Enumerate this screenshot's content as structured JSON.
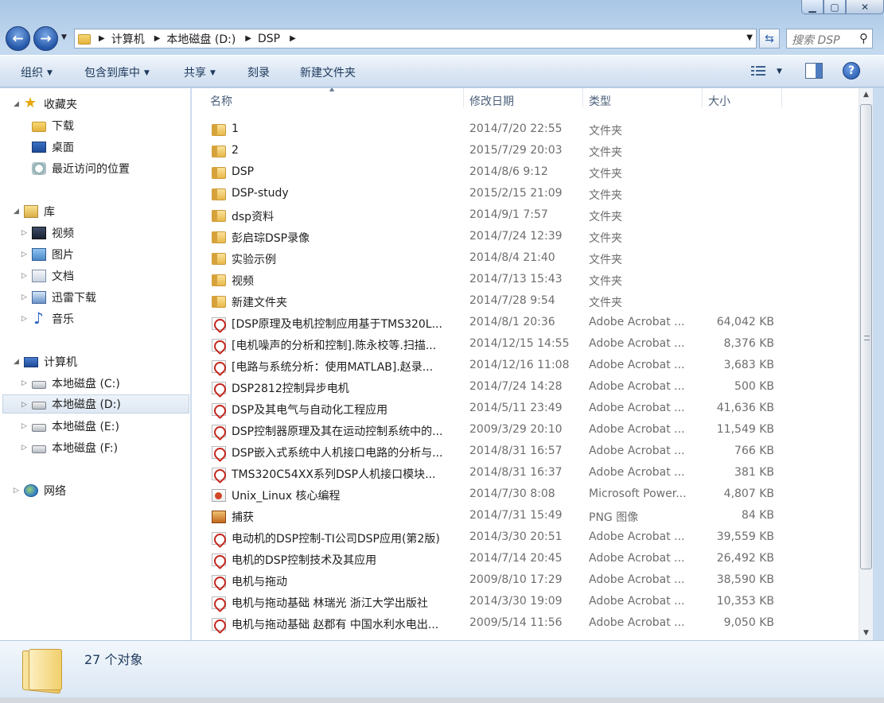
{
  "address": {
    "segments": [
      "计算机",
      "本地磁盘 (D:)",
      "DSP"
    ]
  },
  "search": {
    "placeholder": "搜索 DSP"
  },
  "toolbar": {
    "organize": "组织",
    "include_library": "包含到库中",
    "share": "共享",
    "burn": "刻录",
    "new_folder": "新建文件夹"
  },
  "nav": {
    "favorites": "收藏夹",
    "downloads": "下载",
    "desktop": "桌面",
    "recent": "最近访问的位置",
    "libraries": "库",
    "videos": "视频",
    "pictures": "图片",
    "documents": "文档",
    "xunlei": "迅雷下载",
    "music": "音乐",
    "computer": "计算机",
    "drive_c": "本地磁盘 (C:)",
    "drive_d": "本地磁盘 (D:)",
    "drive_e": "本地磁盘 (E:)",
    "drive_f": "本地磁盘 (F:)",
    "network": "网络"
  },
  "columns": {
    "name": "名称",
    "date": "修改日期",
    "type": "类型",
    "size": "大小"
  },
  "files": [
    {
      "icon": "folder",
      "name": "1",
      "date": "2014/7/20 22:55",
      "type": "文件夹",
      "size": ""
    },
    {
      "icon": "folder",
      "name": "2",
      "date": "2015/7/29 20:03",
      "type": "文件夹",
      "size": ""
    },
    {
      "icon": "folder",
      "name": "DSP",
      "date": "2014/8/6 9:12",
      "type": "文件夹",
      "size": ""
    },
    {
      "icon": "folder",
      "name": "DSP-study",
      "date": "2015/2/15 21:09",
      "type": "文件夹",
      "size": ""
    },
    {
      "icon": "folder",
      "name": "dsp资料",
      "date": "2014/9/1 7:57",
      "type": "文件夹",
      "size": ""
    },
    {
      "icon": "folder",
      "name": "彭启琮DSP录像",
      "date": "2014/7/24 12:39",
      "type": "文件夹",
      "size": ""
    },
    {
      "icon": "folder",
      "name": "实验示例",
      "date": "2014/8/4 21:40",
      "type": "文件夹",
      "size": ""
    },
    {
      "icon": "folder",
      "name": "视频",
      "date": "2014/7/13 15:43",
      "type": "文件夹",
      "size": ""
    },
    {
      "icon": "folder",
      "name": "新建文件夹",
      "date": "2014/7/28 9:54",
      "type": "文件夹",
      "size": ""
    },
    {
      "icon": "pdf",
      "name": "[DSP原理及电机控制应用基于TMS320L...",
      "date": "2014/8/1 20:36",
      "type": "Adobe Acrobat ...",
      "size": "64,042 KB"
    },
    {
      "icon": "pdf",
      "name": "[电机噪声的分析和控制].陈永校等.扫描...",
      "date": "2014/12/15 14:55",
      "type": "Adobe Acrobat ...",
      "size": "8,376 KB"
    },
    {
      "icon": "pdf",
      "name": "[电路与系统分析：使用MATLAB].赵录...",
      "date": "2014/12/16 11:08",
      "type": "Adobe Acrobat ...",
      "size": "3,683 KB"
    },
    {
      "icon": "pdf",
      "name": "DSP2812控制异步电机",
      "date": "2014/7/24 14:28",
      "type": "Adobe Acrobat ...",
      "size": "500 KB"
    },
    {
      "icon": "pdf",
      "name": "DSP及其电气与自动化工程应用",
      "date": "2014/5/11 23:49",
      "type": "Adobe Acrobat ...",
      "size": "41,636 KB"
    },
    {
      "icon": "pdf",
      "name": "DSP控制器原理及其在运动控制系统中的...",
      "date": "2009/3/29 20:10",
      "type": "Adobe Acrobat ...",
      "size": "11,549 KB"
    },
    {
      "icon": "pdf",
      "name": "DSP嵌入式系统中人机接口电路的分析与...",
      "date": "2014/8/31 16:57",
      "type": "Adobe Acrobat ...",
      "size": "766 KB"
    },
    {
      "icon": "pdf",
      "name": "TMS320C54XX系列DSP人机接口模块...",
      "date": "2014/8/31 16:37",
      "type": "Adobe Acrobat ...",
      "size": "381 KB"
    },
    {
      "icon": "ppt",
      "name": "Unix_Linux 核心编程",
      "date": "2014/7/30 8:08",
      "type": "Microsoft Power...",
      "size": "4,807 KB"
    },
    {
      "icon": "png",
      "name": "捕获",
      "date": "2014/7/31 15:49",
      "type": "PNG 图像",
      "size": "84 KB"
    },
    {
      "icon": "pdf",
      "name": "电动机的DSP控制-TI公司DSP应用(第2版)",
      "date": "2014/3/30 20:51",
      "type": "Adobe Acrobat ...",
      "size": "39,559 KB"
    },
    {
      "icon": "pdf",
      "name": "电机的DSP控制技术及其应用",
      "date": "2014/7/14 20:45",
      "type": "Adobe Acrobat ...",
      "size": "26,492 KB"
    },
    {
      "icon": "pdf",
      "name": "电机与拖动",
      "date": "2009/8/10 17:29",
      "type": "Adobe Acrobat ...",
      "size": "38,590 KB"
    },
    {
      "icon": "pdf",
      "name": "电机与拖动基础 林瑞光 浙江大学出版社",
      "date": "2014/3/30 19:09",
      "type": "Adobe Acrobat ...",
      "size": "10,353 KB"
    },
    {
      "icon": "pdf",
      "name": "电机与拖动基础 赵郡有 中国水利水电出...",
      "date": "2009/5/14 11:56",
      "type": "Adobe Acrobat ...",
      "size": "9,050 KB"
    }
  ],
  "status": {
    "count": "27 个对象"
  }
}
